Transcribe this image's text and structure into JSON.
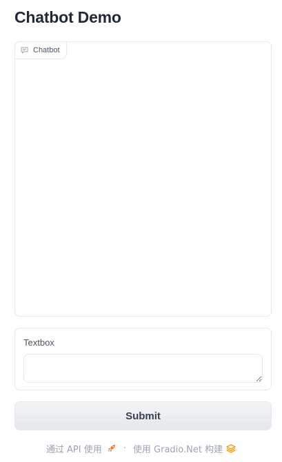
{
  "page": {
    "title": "Chatbot Demo"
  },
  "chatbot": {
    "label": "Chatbot",
    "icon": "chat-bubble-icon",
    "messages": []
  },
  "textbox": {
    "label": "Textbox",
    "value": "",
    "placeholder": ""
  },
  "submit": {
    "label": "Submit"
  },
  "footer": {
    "api_link": "通过 API 使用",
    "api_icon": "rocket-icon",
    "separator": "·",
    "built_with": "使用 Gradio.Net 构建",
    "built_icon": "gradio-logo-icon"
  },
  "colors": {
    "border": "#e5e7eb",
    "label_text": "#4b5563",
    "footer_text": "#9ca3af",
    "button_bg": "#eef0f3",
    "rocket_orange": "#f97316",
    "gradio_orange": "#f59e0b"
  }
}
